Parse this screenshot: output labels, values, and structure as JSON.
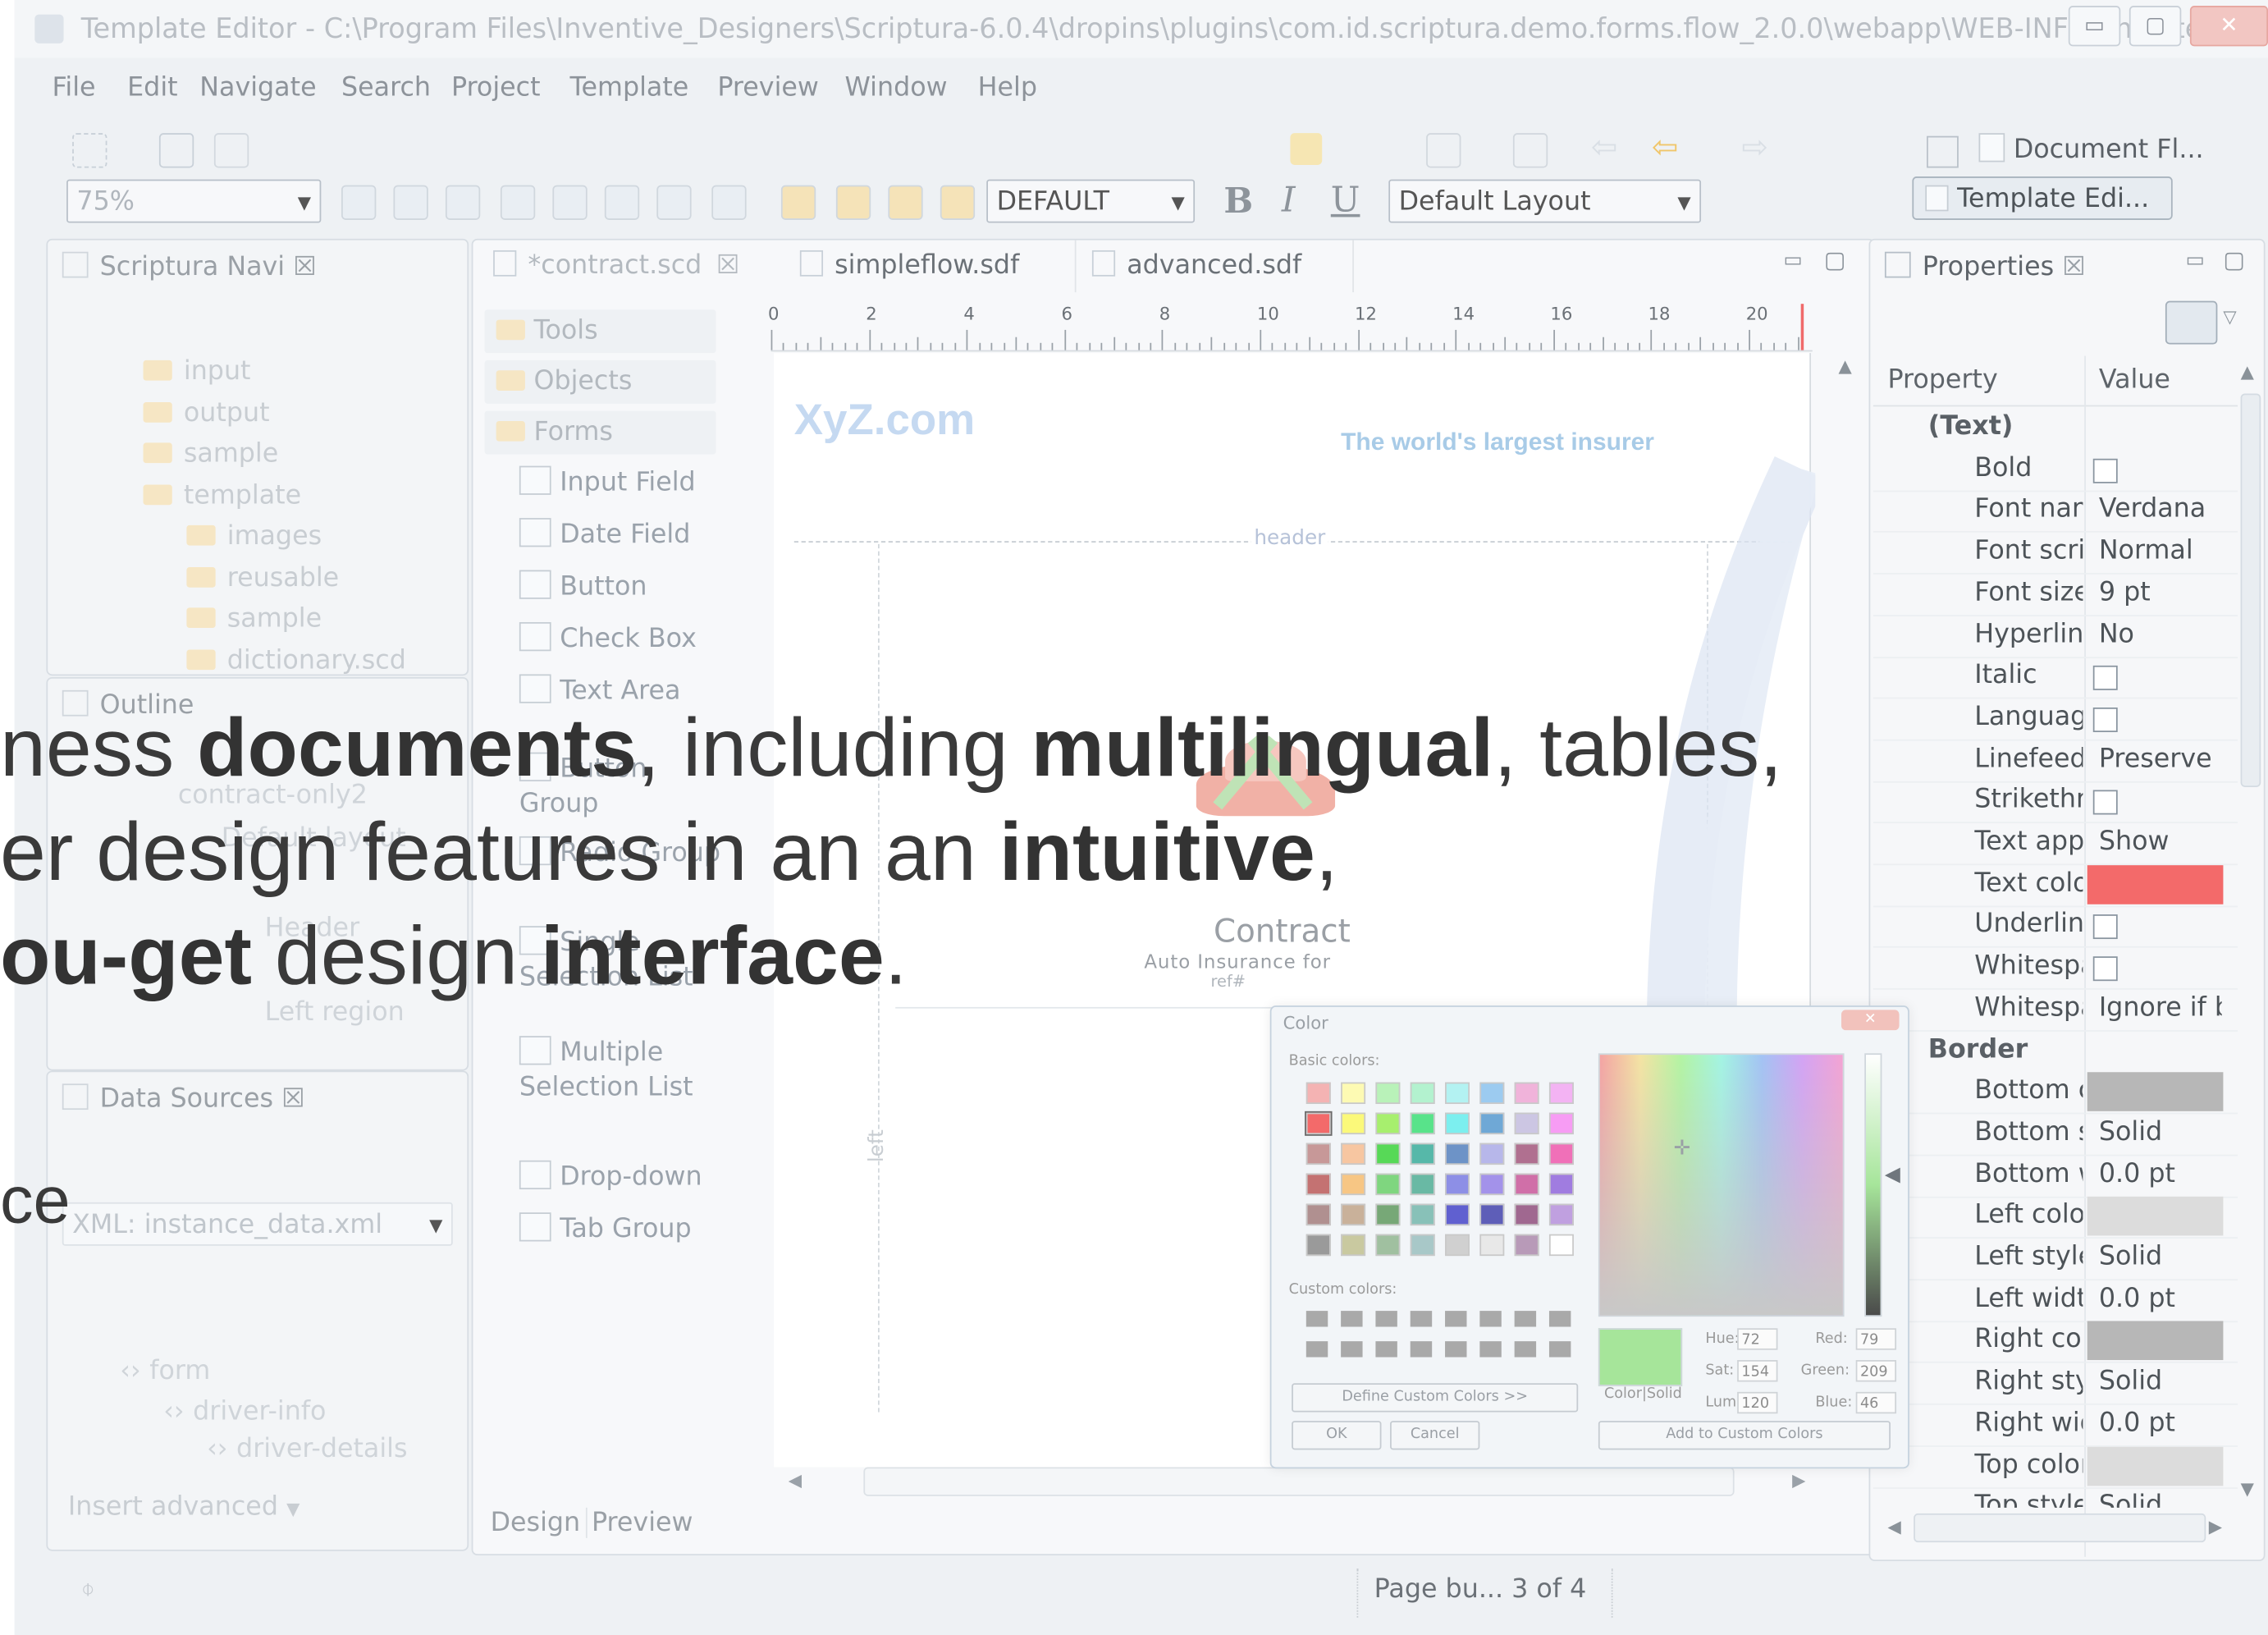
{
  "window": {
    "title": "Template Editor - C:\\Program Files\\Inventive_Designers\\Scriptura-6.0.4\\dropins\\plugins\\com.id.scriptura.demo.forms.flow_2.0.0\\webapp\\WEB-INF\\templates\\ca...",
    "controls": {
      "minimize": "▭",
      "maximize": "▢",
      "close": "✕"
    }
  },
  "menu": [
    "File",
    "Edit",
    "Navigate",
    "Search",
    "Project",
    "Template",
    "Preview",
    "Window",
    "Help"
  ],
  "toolbar": {
    "zoom": "75%",
    "style_combo": "DEFAULT",
    "bold": "B",
    "italic": "I",
    "underline": "U",
    "layout_combo": "Default Layout"
  },
  "perspectives": {
    "document_flow": "Document Fl...",
    "template_editor": "Template Edi..."
  },
  "navigator": {
    "tab": "Scriptura Navi",
    "tree": [
      "input",
      "output",
      "sample",
      "template",
      "images",
      "reusable",
      "sample",
      "dictionary.scd"
    ]
  },
  "outline": {
    "tab": "Outline",
    "tree": [
      "contract-only2",
      "Default layout",
      "Header",
      "Left region"
    ]
  },
  "data_sources": {
    "tab": "Data Sources",
    "combo": "XML: instance_data.xml",
    "tree": [
      "form",
      "driver-info",
      "driver-details"
    ],
    "insert_combo": "Insert advanced"
  },
  "editor": {
    "tabs": [
      "*contract.scd",
      "simpleflow.sdf",
      "advanced.sdf"
    ],
    "palette": {
      "drawers": [
        "Tools",
        "Objects",
        "Forms"
      ],
      "items": [
        "Input Field",
        "Date Field",
        "Button",
        "Check Box",
        "Text Area",
        "Button Group",
        "Radio Group",
        "Single Selection List",
        "Multiple Selection List",
        "Drop-down",
        "Tab Group"
      ]
    },
    "ruler": [
      "0",
      "2",
      "4",
      "6",
      "8",
      "10",
      "12",
      "14",
      "16",
      "18",
      "20"
    ],
    "page": {
      "logo": "XyZ.com",
      "tagline": "The world's largest insurer",
      "header_label": "header",
      "left_label": "left",
      "contract_title": "Contract",
      "contract_sub": "Auto Insurance for",
      "ref": "ref#"
    },
    "bottom_tabs": [
      "Design",
      "Preview"
    ]
  },
  "properties": {
    "tab": "Properties",
    "columns": [
      "Property",
      "Value"
    ],
    "sections": [
      {
        "name": "(Text)",
        "rows": [
          {
            "p": "Bold",
            "v": "",
            "t": "check"
          },
          {
            "p": "Font name",
            "v": "Verdana",
            "t": "text"
          },
          {
            "p": "Font script",
            "v": "Normal",
            "t": "text"
          },
          {
            "p": "Font size",
            "v": "9 pt",
            "t": "text"
          },
          {
            "p": "Hyperlink",
            "v": "No",
            "t": "text"
          },
          {
            "p": "Italic",
            "v": "",
            "t": "check"
          },
          {
            "p": "Language",
            "v": "",
            "t": "check"
          },
          {
            "p": "Linefeed",
            "v": "Preserve",
            "t": "text"
          },
          {
            "p": "Strikethrough",
            "v": "",
            "t": "check"
          },
          {
            "p": "Text appearance",
            "v": "Show",
            "t": "text"
          },
          {
            "p": "Text color",
            "v": "#f36a6a",
            "t": "color"
          },
          {
            "p": "Underline",
            "v": "",
            "t": "check"
          },
          {
            "p": "Whitespace",
            "v": "",
            "t": "check"
          },
          {
            "p": "Whitespace handling",
            "v": "Ignore if b",
            "t": "text"
          }
        ]
      },
      {
        "name": "Border",
        "rows": [
          {
            "p": "Bottom color",
            "v": "#b7b7b7",
            "t": "color"
          },
          {
            "p": "Bottom style",
            "v": "Solid",
            "t": "text"
          },
          {
            "p": "Bottom width",
            "v": "0.0 pt",
            "t": "text"
          },
          {
            "p": "Left color",
            "v": "#dcdcdc",
            "t": "color"
          },
          {
            "p": "Left style",
            "v": "Solid",
            "t": "text"
          },
          {
            "p": "Left width",
            "v": "0.0 pt",
            "t": "text"
          },
          {
            "p": "Right color",
            "v": "#b7b7b7",
            "t": "color"
          },
          {
            "p": "Right style",
            "v": "Solid",
            "t": "text"
          },
          {
            "p": "Right width",
            "v": "0.0 pt",
            "t": "text"
          },
          {
            "p": "Top color",
            "v": "#dcdcdc",
            "t": "color"
          },
          {
            "p": "Top style",
            "v": "Solid",
            "t": "text"
          }
        ]
      }
    ]
  },
  "color_dialog": {
    "title": "Color",
    "basic_label": "Basic colors:",
    "custom_label": "Custom colors:",
    "define_btn": "Define Custom Colors >>",
    "ok": "OK",
    "cancel": "Cancel",
    "add_btn": "Add to Custom Colors",
    "color_solid": "Color|Solid",
    "hue_label": "Hue:",
    "hue": "72",
    "sat_label": "Sat:",
    "sat": "154",
    "lum_label": "Lum:",
    "lum": "120",
    "red_label": "Red:",
    "red": "79",
    "green_label": "Green:",
    "green": "209",
    "blue_label": "Blue:",
    "blue": "46",
    "selected_color": "#a6e59a",
    "basic_colors": [
      "#f4b3b3",
      "#fdfab3",
      "#b9f2b9",
      "#b3f2cf",
      "#b3f2f2",
      "#9ccbf0",
      "#f0b3da",
      "#f3b3f3",
      "#f36a6a",
      "#fbf97a",
      "#a7ef6e",
      "#58e38a",
      "#7cefef",
      "#6fa8d6",
      "#ccc6e3",
      "#f79cf4",
      "#c79898",
      "#f7c6a1",
      "#57d957",
      "#56b8a9",
      "#6d93c7",
      "#b7b7ea",
      "#b07090",
      "#f070b8",
      "#c47272",
      "#f7c684",
      "#7fd67f",
      "#69b9a4",
      "#8d8fe6",
      "#a392ea",
      "#d06fa8",
      "#a07ce0",
      "#b09090",
      "#c9b19a",
      "#77a877",
      "#88c1b8",
      "#6060d0",
      "#5e5eb8",
      "#a06890",
      "#c0a0e0",
      "#9a9a9a",
      "#c9c9a0",
      "#a0c0a0",
      "#a8c8c8",
      "#d0d0d0",
      "#e8e8e8",
      "#b89ab8",
      "#ffffff"
    ]
  },
  "status": {
    "page": "Page bu... 3 of 4"
  },
  "overlay": {
    "line1": {
      "a": "ness ",
      "b": "documents",
      "c": ", including ",
      "d": "multilingual",
      "e": ", tables,"
    },
    "line2": {
      "a": "er design features in an an ",
      "b": "intuitive",
      "c": ","
    },
    "line3": {
      "a": "ou-get",
      "b": " design ",
      "c": "interface",
      "d": "."
    },
    "line4": "ce"
  }
}
